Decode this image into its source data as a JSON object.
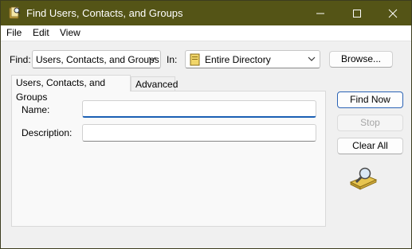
{
  "window": {
    "title": "Find Users, Contacts, and Groups",
    "titlebar_color": "#545416"
  },
  "menu": [
    "File",
    "Edit",
    "View"
  ],
  "find": {
    "label": "Find:",
    "selected": "Users, Contacts, and Groups"
  },
  "in": {
    "label": "In:",
    "selected": "Entire Directory",
    "icon": "directory-book-icon"
  },
  "buttons": {
    "browse": "Browse...",
    "find_now": "Find Now",
    "stop": "Stop",
    "clear_all": "Clear All"
  },
  "tabs": [
    {
      "label": "Users, Contacts, and Groups",
      "active": true
    },
    {
      "label": "Advanced",
      "active": false
    }
  ],
  "fields": {
    "name_label": "Name:",
    "name_value": "",
    "description_label": "Description:",
    "description_value": ""
  },
  "decor": {
    "search_icon": "magnifier-over-directory-icon"
  },
  "colors": {
    "accent": "#1a5fb4",
    "disabled_text": "#a6a6a6"
  }
}
